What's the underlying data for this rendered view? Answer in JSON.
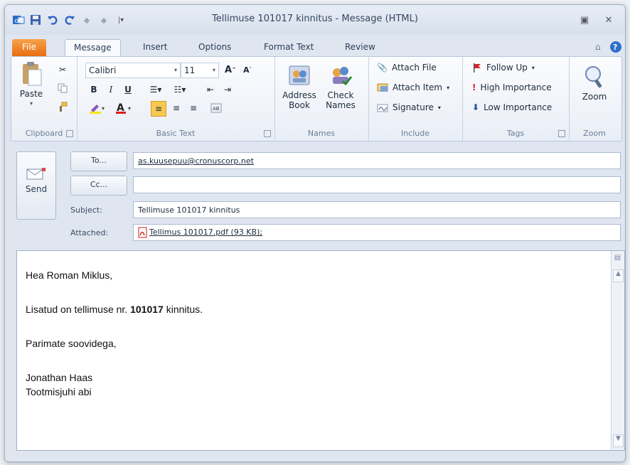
{
  "window": {
    "title": "Tellimuse 101017 kinnitus - Message (HTML)"
  },
  "tabs": [
    "File",
    "Message",
    "Insert",
    "Options",
    "Format Text",
    "Review"
  ],
  "ribbon": {
    "clipboard": {
      "paste": "Paste",
      "label": "Clipboard"
    },
    "basic_text": {
      "font": "Calibri",
      "size": "11",
      "label": "Basic Text",
      "bold": "B",
      "italic": "I",
      "underline": "U"
    },
    "names": {
      "address_book": [
        "Address",
        "Book"
      ],
      "check_names": [
        "Check",
        "Names"
      ],
      "label": "Names"
    },
    "include": {
      "attach_file": "Attach File",
      "attach_item": "Attach Item",
      "signature": "Signature",
      "label": "Include"
    },
    "tags": {
      "follow_up": "Follow Up",
      "high": "High Importance",
      "low": "Low Importance",
      "label": "Tags"
    },
    "zoom": {
      "button": "Zoom",
      "label": "Zoom"
    }
  },
  "header": {
    "send": "Send",
    "to_button": "To...",
    "cc_button": "Cc...",
    "to_value": "as.kuusepuu@cronuscorp.net",
    "cc_value": "",
    "subject_label": "Subject:",
    "subject_value": "Tellimuse 101017 kinnitus",
    "attached_label": "Attached:",
    "attachment": "Tellimus 101017.pdf (93 KB);"
  },
  "body": {
    "greeting": "Hea Roman Miklus,",
    "line_pre": "Lisatud on tellimuse nr. ",
    "line_bold": "101017",
    "line_post": " kinnitus.",
    "closing": "Parimate soovidega,",
    "sig_name": "Jonathan Haas",
    "sig_title": "Tootmisjuhi abi"
  },
  "colors": {
    "file_tab": "#e8761a",
    "accent": "#2b5797"
  }
}
